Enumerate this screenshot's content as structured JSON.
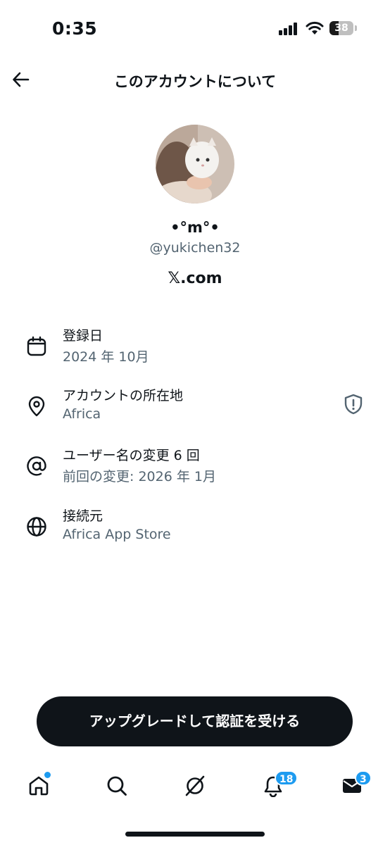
{
  "status_bar": {
    "time": "0:35",
    "battery": "38",
    "battery_level": 0.38
  },
  "header": {
    "title": "このアカウントについて"
  },
  "profile": {
    "display_name": "•°m°•",
    "handle": "@yukichen32",
    "site": "𝕏.com"
  },
  "info": [
    {
      "icon": "calendar-icon",
      "label": "登録日",
      "value": "2024 年 10月"
    },
    {
      "icon": "location-pin-icon",
      "label": "アカウントの所在地",
      "value": "Africa"
    },
    {
      "icon": "at-sign-icon",
      "label": "ユーザー名の変更 6 回",
      "value": "前回の変更: 2026 年 1月"
    },
    {
      "icon": "globe-icon",
      "label": "接続元",
      "value": "Africa App Store"
    }
  ],
  "upgrade_button": {
    "label": "アップグレードして認証を受ける"
  },
  "tabs": {
    "home": {
      "icon": "home-icon"
    },
    "search": {
      "icon": "search-icon"
    },
    "grok": {
      "icon": "grok-icon"
    },
    "notifications": {
      "icon": "bell-icon",
      "badge": "18"
    },
    "messages": {
      "icon": "envelope-icon",
      "badge": "3"
    }
  },
  "colors": {
    "text": "#0f1419",
    "secondary": "#536471",
    "accent": "#1d9bf0",
    "button_bg": "#0f1419"
  }
}
